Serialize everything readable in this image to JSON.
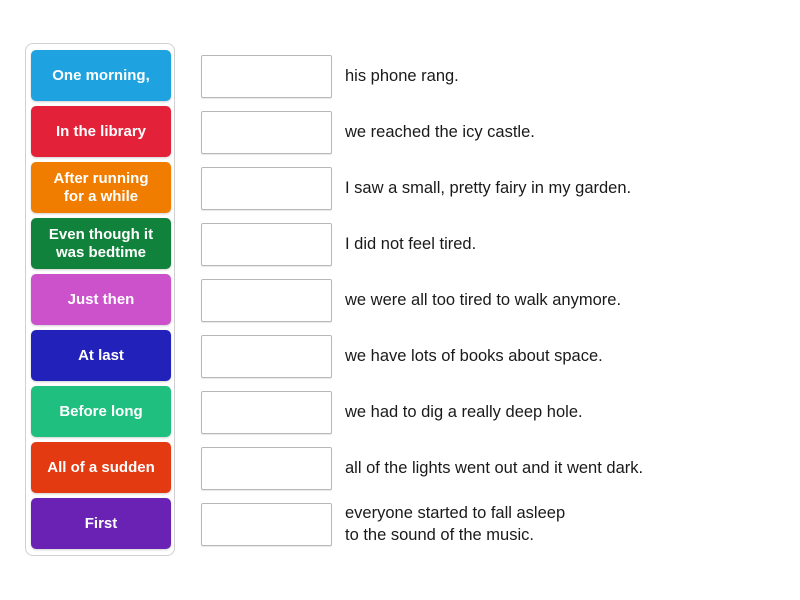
{
  "activity": {
    "type": "match-up-drag-and-drop",
    "tray": {
      "name": "sentence-starter-tiles",
      "tiles": [
        {
          "label": "One morning,",
          "color": "#1fa3e0"
        },
        {
          "label": "In the library",
          "color": "#e32139"
        },
        {
          "label": "After running\nfor a while",
          "color": "#f07d00"
        },
        {
          "label": "Even though it\nwas bedtime",
          "color": "#11823b"
        },
        {
          "label": "Just then",
          "color": "#cc52cc"
        },
        {
          "label": "At last",
          "color": "#2222bb"
        },
        {
          "label": "Before long",
          "color": "#1fbf7f"
        },
        {
          "label": "All of a sudden",
          "color": "#e33a12"
        },
        {
          "label": "First",
          "color": "#6a22b5"
        }
      ]
    },
    "answers": [
      {
        "drop_value": "",
        "text": "his phone rang."
      },
      {
        "drop_value": "",
        "text": "we reached the icy castle."
      },
      {
        "drop_value": "",
        "text": "I saw a small, pretty fairy in my garden."
      },
      {
        "drop_value": "",
        "text": "I did not feel tired."
      },
      {
        "drop_value": "",
        "text": "we were all too tired to walk anymore."
      },
      {
        "drop_value": "",
        "text": "we have lots of books about space."
      },
      {
        "drop_value": "",
        "text": "we had to dig a really deep hole."
      },
      {
        "drop_value": "",
        "text": "all of the lights went out and it went dark."
      },
      {
        "drop_value": "",
        "text": "everyone started to fall asleep\nto the sound of the music."
      }
    ]
  }
}
